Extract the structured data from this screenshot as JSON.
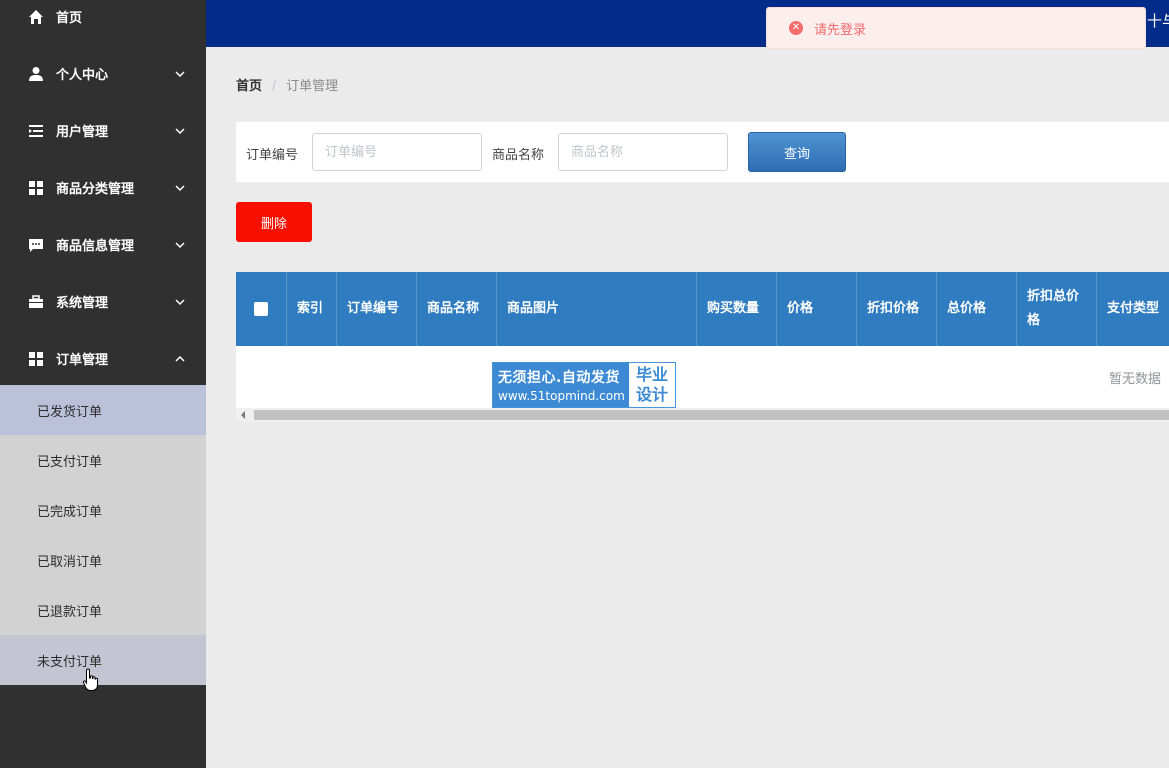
{
  "sidebar": {
    "items": [
      {
        "label": "首页",
        "icon": "home-icon",
        "chevron": "none"
      },
      {
        "label": "个人中心",
        "icon": "user-icon",
        "chevron": "down"
      },
      {
        "label": "用户管理",
        "icon": "list-icon",
        "chevron": "down"
      },
      {
        "label": "商品分类管理",
        "icon": "grid-icon",
        "chevron": "down"
      },
      {
        "label": "商品信息管理",
        "icon": "chat-icon",
        "chevron": "down"
      },
      {
        "label": "系统管理",
        "icon": "briefcase-icon",
        "chevron": "down"
      },
      {
        "label": "订单管理",
        "icon": "grid-icon",
        "chevron": "up"
      }
    ],
    "order_subitems": [
      {
        "label": "已发货订单",
        "state": "active"
      },
      {
        "label": "已支付订单",
        "state": "normal"
      },
      {
        "label": "已完成订单",
        "state": "normal"
      },
      {
        "label": "已取消订单",
        "state": "normal"
      },
      {
        "label": "已退款订单",
        "state": "normal"
      },
      {
        "label": "未支付订单",
        "state": "hover"
      }
    ]
  },
  "topbar": {
    "edge_text": "十与"
  },
  "toast": {
    "message": "请先登录",
    "icon": "error-circle-icon",
    "color": "#f56c6c"
  },
  "breadcrumb": {
    "home": "首页",
    "separator": "/",
    "current": "订单管理"
  },
  "search": {
    "order_no_label": "订单编号",
    "order_no_placeholder": "订单编号",
    "order_no_value": "",
    "product_label": "商品名称",
    "product_placeholder": "商品名称",
    "product_value": "",
    "query_label": "查询"
  },
  "delete_label": "删除",
  "table": {
    "columns": [
      "索引",
      "订单编号",
      "商品名称",
      "商品图片",
      "购买数量",
      "价格",
      "折扣价格",
      "总价格",
      "折扣总价格",
      "支付类型"
    ],
    "empty_text": "暂无数据"
  },
  "watermark": {
    "line1": "无须担心.自动发货",
    "line2": "www.51topmind.com",
    "right1": "毕业",
    "right2": "设计"
  },
  "colors": {
    "sidebar_bg": "#303030",
    "topbar_bg": "#032b8a",
    "table_header": "#2f7cc0",
    "delete_button": "#f80f00",
    "query_button": "#3b7fc4"
  }
}
